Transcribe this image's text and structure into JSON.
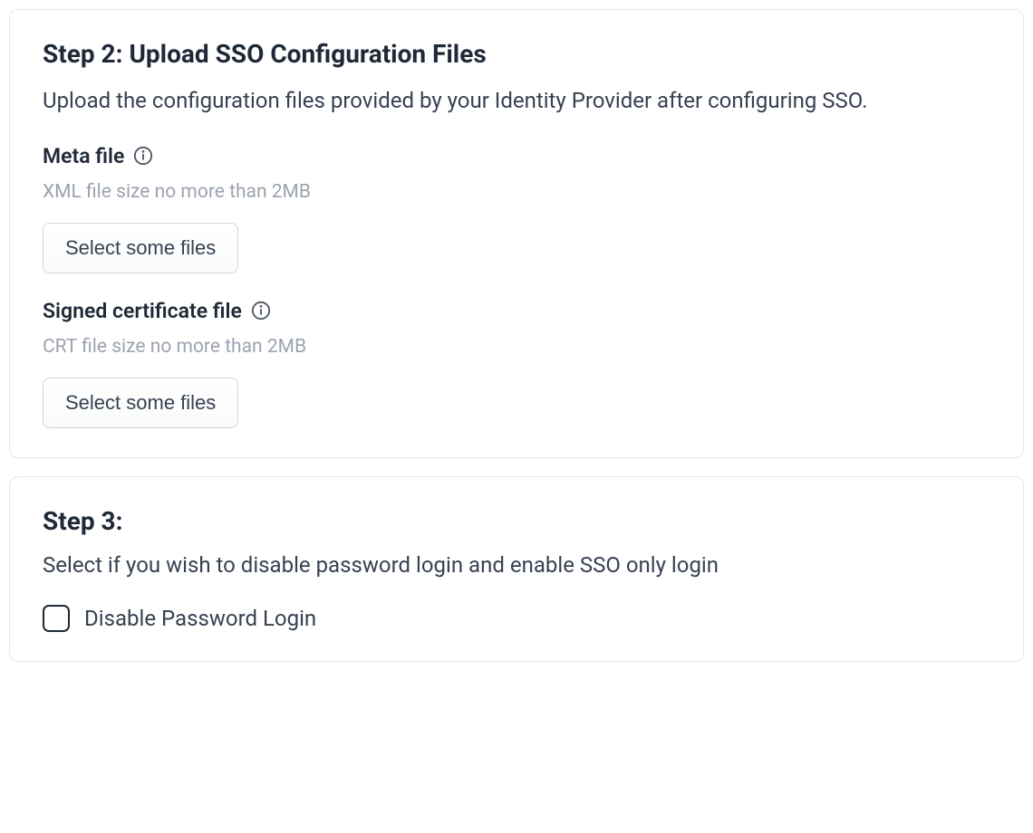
{
  "step2": {
    "title": "Step 2: Upload SSO Configuration Files",
    "description": "Upload the configuration files provided by your Identity Provider after configuring SSO.",
    "meta": {
      "label": "Meta file",
      "hint": "XML file size no more than 2MB",
      "button": "Select some files"
    },
    "cert": {
      "label": "Signed certificate file",
      "hint": "CRT file size no more than 2MB",
      "button": "Select some files"
    }
  },
  "step3": {
    "title": "Step 3:",
    "description": "Select if you wish to disable password login and enable SSO only login",
    "checkboxLabel": "Disable Password Login",
    "checked": false
  }
}
